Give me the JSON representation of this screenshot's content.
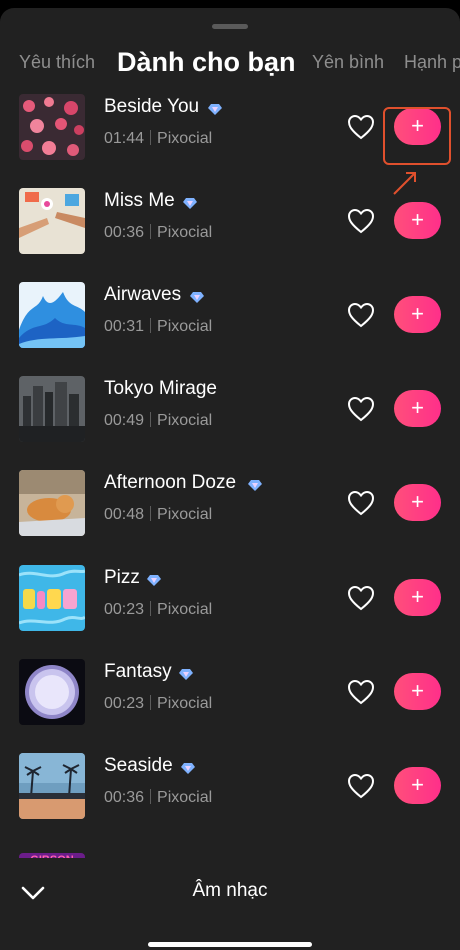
{
  "tabs": [
    {
      "label": "Yêu thích"
    },
    {
      "label": "Dành cho bạn"
    },
    {
      "label": "Yên bình"
    },
    {
      "label": "Hạnh phúc"
    }
  ],
  "tracks": [
    {
      "title": "Beside You",
      "duration": "01:44",
      "artist": "Pixocial"
    },
    {
      "title": "Miss Me",
      "duration": "00:36",
      "artist": "Pixocial"
    },
    {
      "title": "Airwaves",
      "duration": "00:31",
      "artist": "Pixocial"
    },
    {
      "title": "Tokyo Mirage",
      "duration": "00:49",
      "artist": "Pixocial"
    },
    {
      "title": "Afternoon Doze",
      "duration": "00:48",
      "artist": "Pixocial"
    },
    {
      "title": "Pizz",
      "duration": "00:23",
      "artist": "Pixocial"
    },
    {
      "title": "Fantasy",
      "duration": "00:23",
      "artist": "Pixocial"
    },
    {
      "title": "Seaside",
      "duration": "00:36",
      "artist": "Pixocial"
    }
  ],
  "add_label": "+",
  "partial_thumb_text": "GIBSON",
  "bottom": {
    "title": "Âm nhạc"
  },
  "colors": {
    "accent": "#ff3d83",
    "highlight": "#e0502d",
    "background": "#212121"
  }
}
